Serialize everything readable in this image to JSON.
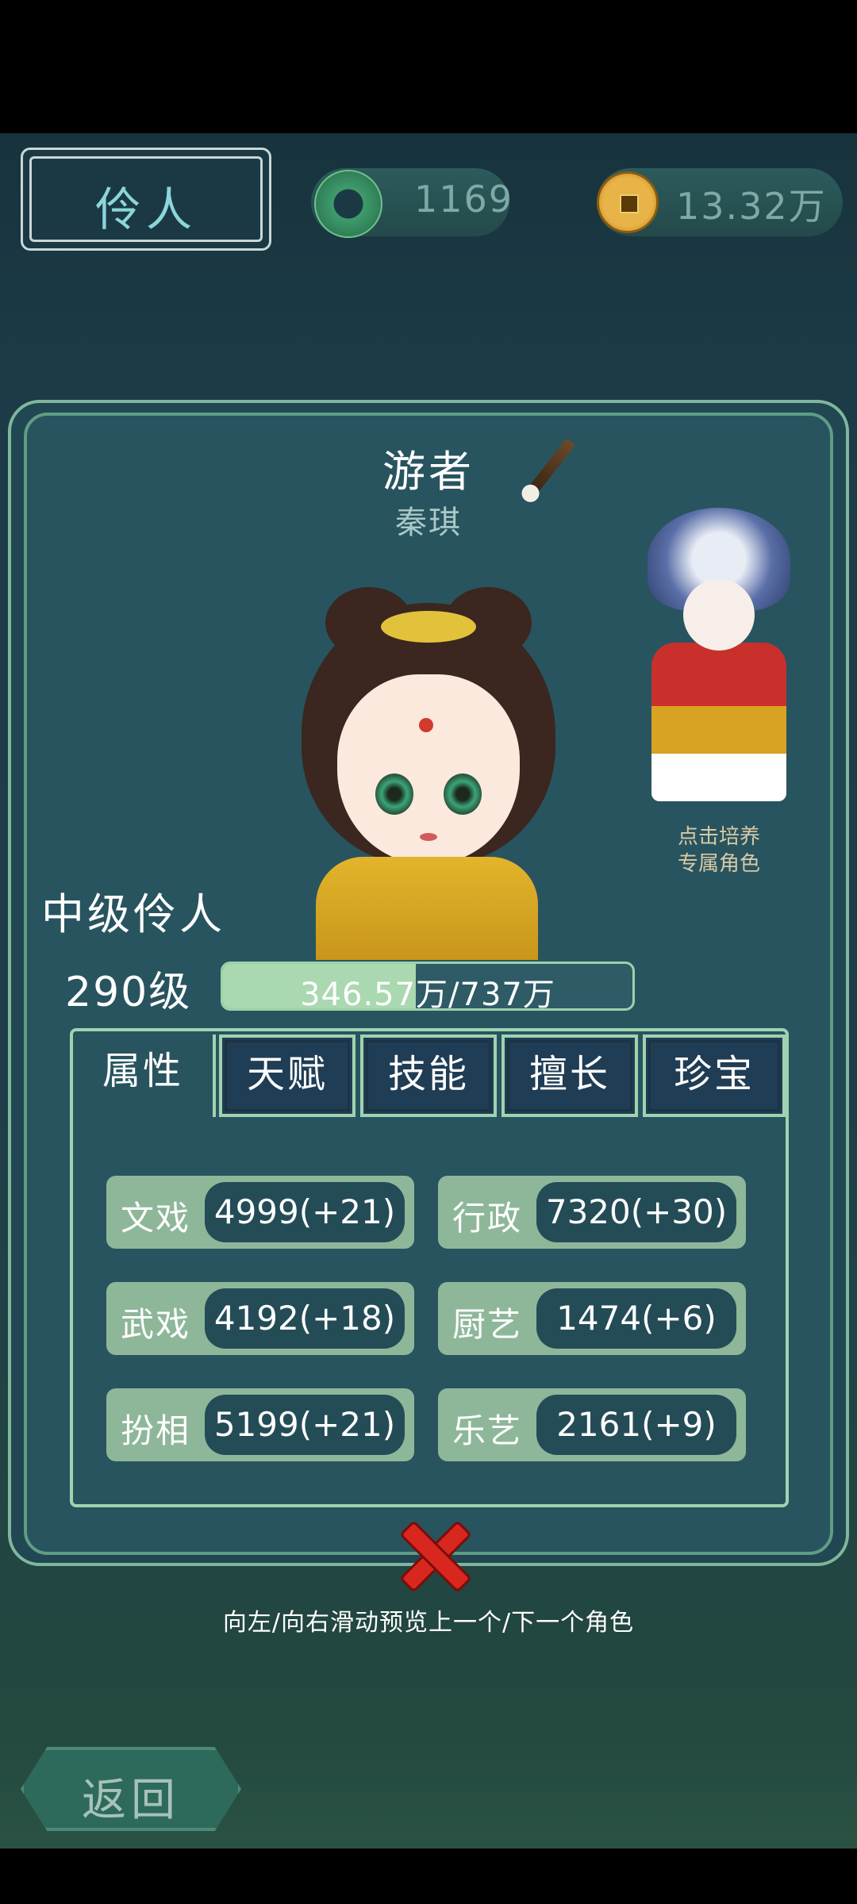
{
  "header": {
    "title": "伶人",
    "jade_count": "1169",
    "coin_count": "13.32万"
  },
  "character": {
    "title": "游者",
    "name": "秦琪",
    "rank": "中级伶人",
    "level": "290级",
    "exp_text": "346.57万/737万",
    "exp_fraction": 0.47
  },
  "special_role": {
    "label_line1": "点击培养",
    "label_line2": "专属角色"
  },
  "tabs": [
    {
      "label": "属性",
      "active": true
    },
    {
      "label": "天赋",
      "active": false
    },
    {
      "label": "技能",
      "active": false
    },
    {
      "label": "擅长",
      "active": false
    },
    {
      "label": "珍宝",
      "active": false
    }
  ],
  "stats": [
    {
      "label": "文戏",
      "value": "4999(+21)"
    },
    {
      "label": "行政",
      "value": "7320(+30)"
    },
    {
      "label": "武戏",
      "value": "4192(+18)"
    },
    {
      "label": "厨艺",
      "value": "1474(+6)"
    },
    {
      "label": "扮相",
      "value": "5199(+21)"
    },
    {
      "label": "乐艺",
      "value": "2161(+9)"
    }
  ],
  "hint": "向左/向右滑动预览上一个/下一个角色",
  "back_label": "返回",
  "icons": {
    "jade": "jade-disc-icon",
    "coin": "copper-coin-icon",
    "edit": "brush-icon",
    "close": "close-icon"
  },
  "colors": {
    "accent_green": "#9fd3b0",
    "panel": "#28545f",
    "close_red": "#d8271f"
  }
}
